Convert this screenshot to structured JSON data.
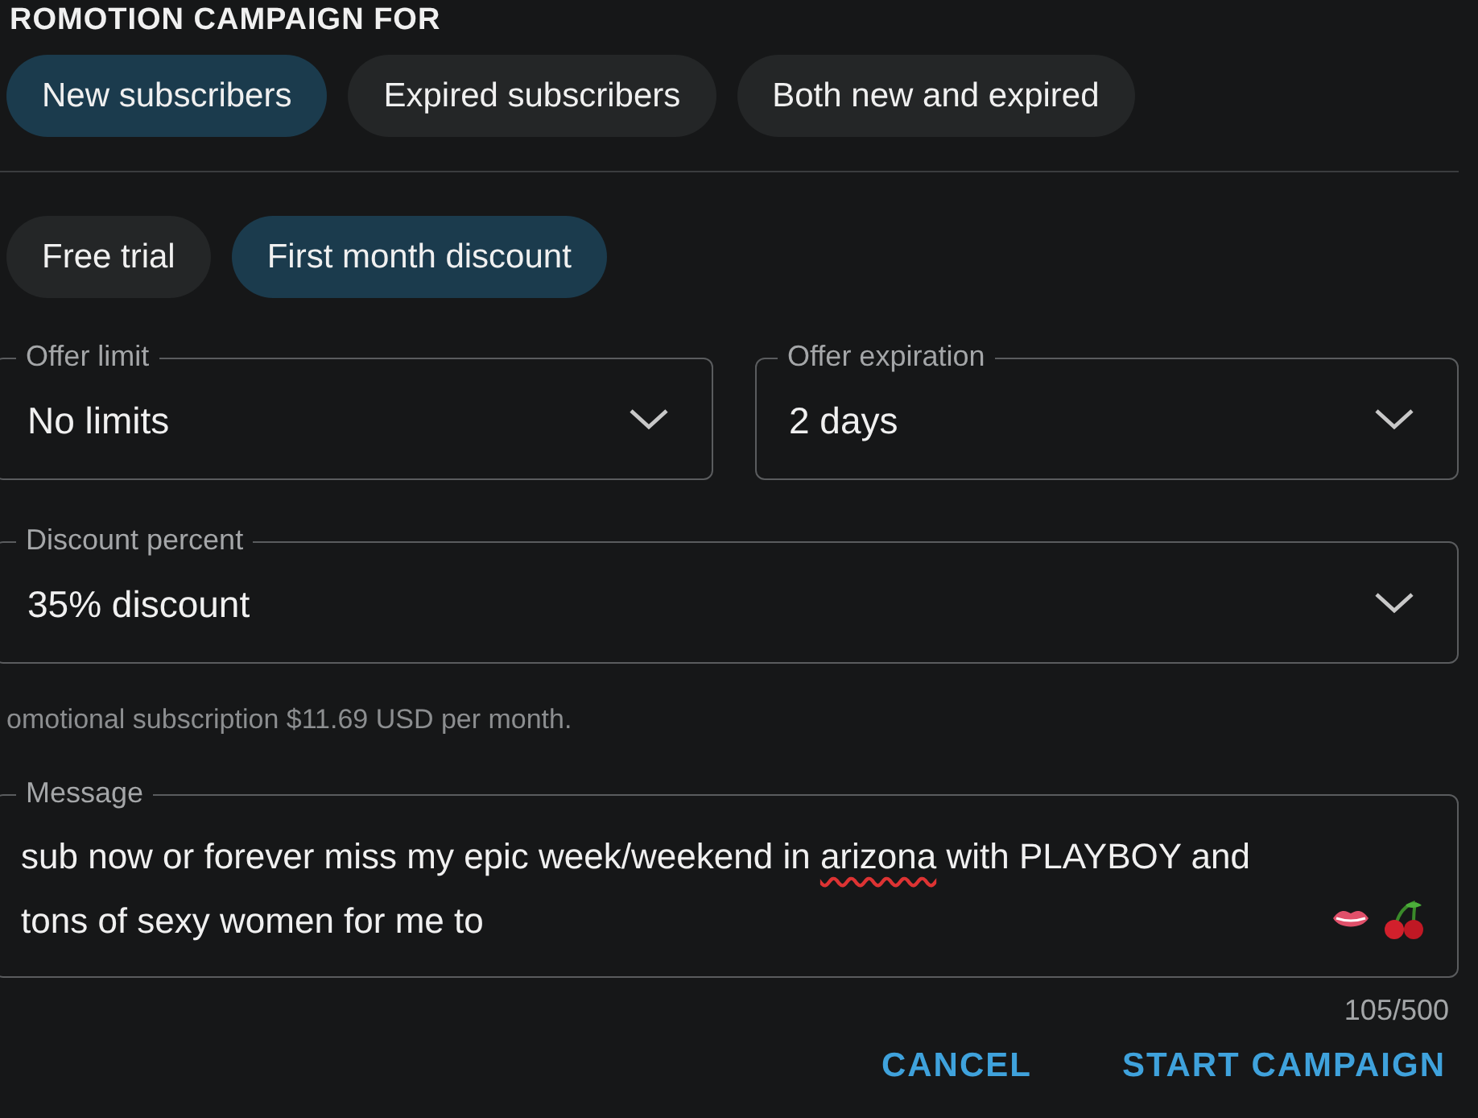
{
  "title": "ROMOTION CAMPAIGN FOR",
  "audience": [
    {
      "label": "New subscribers",
      "selected": true
    },
    {
      "label": "Expired subscribers",
      "selected": false
    },
    {
      "label": "Both new and expired",
      "selected": false
    }
  ],
  "offer_type": [
    {
      "label": "Free trial",
      "selected": false
    },
    {
      "label": "First month discount",
      "selected": true
    }
  ],
  "fields": [
    {
      "label": "Offer limit",
      "value": "No limits"
    },
    {
      "label": "Offer expiration",
      "value": "2 days"
    }
  ],
  "discount": {
    "label": "Discount percent",
    "value": "35% discount"
  },
  "helper_text": "omotional subscription $11.69 USD per month.",
  "message": {
    "label": "Message",
    "parts": [
      {
        "text": "sub now or forever miss my epic week/weekend in ",
        "misspelled": false
      },
      {
        "text": "arizona",
        "misspelled": true
      },
      {
        "text": " with PLAYBOY and tons of sexy women for me to",
        "misspelled": false
      }
    ],
    "counter": "105/500"
  },
  "buttons": [
    "CANCEL",
    "START CAMPAIGN"
  ]
}
